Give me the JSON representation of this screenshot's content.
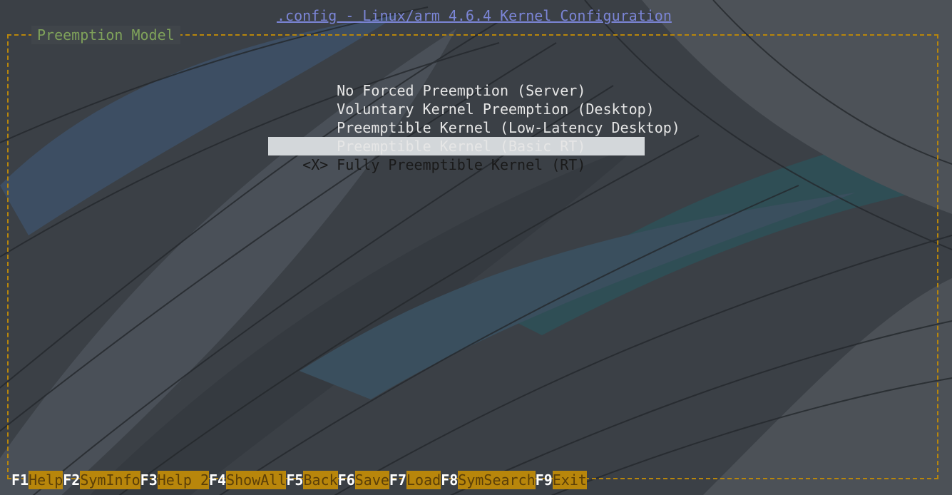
{
  "window": {
    "title": ".config - Linux/arm 4.6.4 Kernel Configuration"
  },
  "dialog": {
    "title": "Preemption Model",
    "items": [
      {
        "mark": "",
        "label": "No Forced Preemption (Server)",
        "selected": false
      },
      {
        "mark": "",
        "label": "Voluntary Kernel Preemption (Desktop)",
        "selected": false
      },
      {
        "mark": "",
        "label": "Preemptible Kernel (Low-Latency Desktop)",
        "selected": false
      },
      {
        "mark": "",
        "label": "Preemptible Kernel (Basic RT)",
        "selected": false
      },
      {
        "mark": "<X>",
        "label": "Fully Preemptible Kernel (RT)",
        "selected": true
      }
    ]
  },
  "function_keys": [
    {
      "key": "F1",
      "label": "Help"
    },
    {
      "key": "F2",
      "label": "SymInfo"
    },
    {
      "key": "F3",
      "label": "Help 2"
    },
    {
      "key": "F4",
      "label": "ShowAll"
    },
    {
      "key": "F5",
      "label": "Back"
    },
    {
      "key": "F6",
      "label": "Save"
    },
    {
      "key": "F7",
      "label": "Load"
    },
    {
      "key": "F8",
      "label": "SymSearch"
    },
    {
      "key": "F9",
      "label": "Exit"
    }
  ],
  "colors": {
    "title": "#7b85d6",
    "frame_border": "#b8860b",
    "frame_title": "#7fa25a",
    "selection_bg": "#d3d7da",
    "fkey_label_bg": "#b8860b"
  }
}
